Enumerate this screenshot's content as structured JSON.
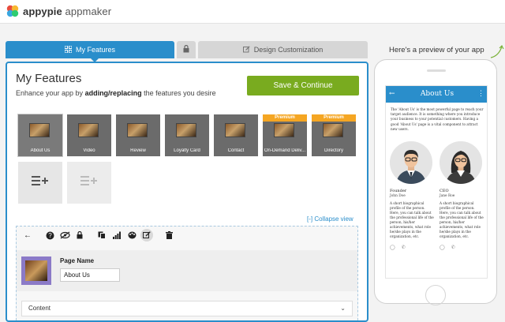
{
  "brand": {
    "name_bold": "appypie",
    "name_light": "appmaker"
  },
  "tabs": [
    {
      "label": "My Features"
    },
    {
      "label": ""
    },
    {
      "label": "Design Customization"
    }
  ],
  "panel": {
    "title": "My Features",
    "subtitle_pre": "Enhance your app by ",
    "subtitle_bold": "adding/replacing",
    "subtitle_post": " the features you desire",
    "save_label": "Save & Continue",
    "collapse_label": "[-] Collapse view"
  },
  "features": [
    {
      "label": "About Us",
      "premium": ""
    },
    {
      "label": "Video",
      "premium": ""
    },
    {
      "label": "Review",
      "premium": ""
    },
    {
      "label": "Loyalty Card",
      "premium": ""
    },
    {
      "label": "Contact",
      "premium": ""
    },
    {
      "label": "On-Demand Deliv...",
      "premium": "Premium"
    },
    {
      "label": "Directory",
      "premium": "Premium"
    }
  ],
  "editor": {
    "page_name_label": "Page Name",
    "page_name_value": "About Us",
    "content_label": "Content"
  },
  "preview": {
    "title": "Here's a preview of your app",
    "app_title": "About Us",
    "intro": "The 'About Us' is the most powerful page to reach your target audience. It is something where you introduce your business to your potential customers. Having a good 'About Us' page is a vital component to attract new users.",
    "people": [
      {
        "role": "Founder",
        "name": "John Doe",
        "bio": "A short biographical profile of the person. Here, you can talk about the professional life of the person, his/her achievements, what role he/she plays in the organization, etc."
      },
      {
        "role": "CEO",
        "name": "Jane Roe",
        "bio": "A short biographical profile of the person. Here, you can talk about the professional life of the person, his/her achievements, what role he/she plays in the organization, etc."
      }
    ]
  },
  "colors": {
    "accent": "#2a8ecb",
    "save": "#79ab1f",
    "premium": "#f5a623"
  }
}
